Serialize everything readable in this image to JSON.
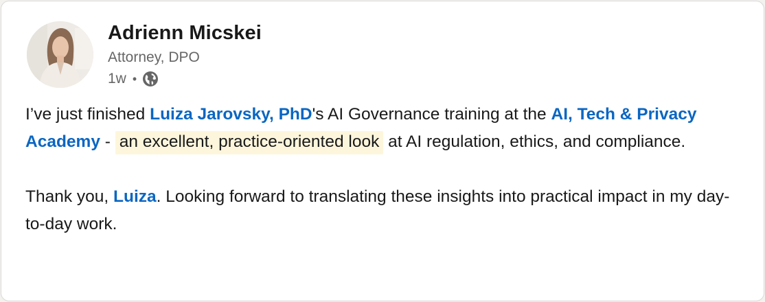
{
  "author": {
    "name": "Adrienn Micskei",
    "headline": "Attorney, DPO",
    "time": "1w",
    "separator": "•",
    "visibility_icon": "globe-icon"
  },
  "post": {
    "p1": {
      "t1": "I’ve just finished ",
      "mention1": "Luiza Jarovsky, PhD",
      "t2": "'s AI Governance training at the ",
      "mention2": "AI, Tech & Privacy Academy",
      "t3": " - ",
      "highlight": "an excellent, practice-oriented look",
      "t4": " at AI regulation, ethics, and compliance."
    },
    "p2": {
      "t1": "Thank you, ",
      "mention": "Luiza",
      "t2": ". Looking forward to translating these insights into practical impact in my day-to-day work."
    }
  },
  "colors": {
    "mention": "#0a66c2",
    "highlight_bg": "#fdf6dc",
    "text": "#191919",
    "secondary_text": "#666666"
  }
}
